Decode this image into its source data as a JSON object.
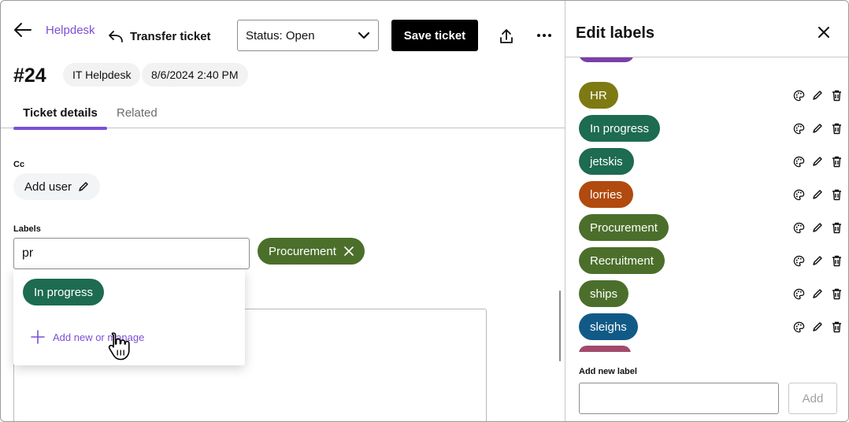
{
  "header": {
    "breadcrumb": "Helpdesk",
    "transfer_label": "Transfer ticket",
    "status_value": "Status: Open",
    "save_label": "Save ticket"
  },
  "ticket": {
    "number": "#24",
    "group": "IT Helpdesk",
    "created": "8/6/2024 2:40 PM"
  },
  "tabs": [
    {
      "label": "Ticket details",
      "active": true
    },
    {
      "label": "Related",
      "active": false
    }
  ],
  "form": {
    "cc_label": "Cc",
    "add_user_label": "Add user",
    "labels_label": "Labels",
    "labels_input_value": "pr",
    "selected_labels": [
      {
        "name": "Procurement",
        "color": "#4b6f2b"
      }
    ]
  },
  "suggestions": {
    "items": [
      {
        "name": "In progress",
        "color": "#1d6b50"
      }
    ],
    "add_manage_label": "Add new or manage"
  },
  "panel": {
    "title": "Edit labels",
    "labels": [
      {
        "name": "HR",
        "color": "#7d7a13"
      },
      {
        "name": "In progress",
        "color": "#1d6b50"
      },
      {
        "name": "jetskis",
        "color": "#1d6b50"
      },
      {
        "name": "lorries",
        "color": "#b14a0e"
      },
      {
        "name": "Procurement",
        "color": "#4b6f2b"
      },
      {
        "name": "Recruitment",
        "color": "#4b6f2b"
      },
      {
        "name": "ships",
        "color": "#4b6f2b"
      },
      {
        "name": "sleighs",
        "color": "#115a87"
      }
    ],
    "new_label_caption": "Add new label",
    "new_label_value": "",
    "add_button_label": "Add"
  },
  "colors": {
    "accent": "#7b4fd6",
    "primary_button": "#000000"
  }
}
